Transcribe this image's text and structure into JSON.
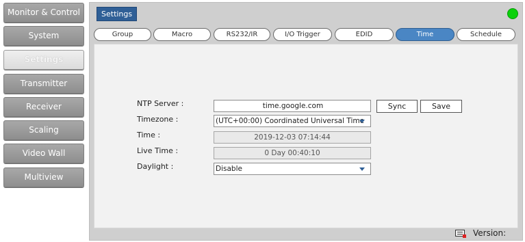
{
  "sidebar": {
    "items": [
      {
        "label": "Monitor & Control",
        "active": false
      },
      {
        "label": "System",
        "active": false
      },
      {
        "label": "Settings",
        "active": true
      },
      {
        "label": "Transmitter",
        "active": false
      },
      {
        "label": "Receiver",
        "active": false
      },
      {
        "label": "Scaling",
        "active": false
      },
      {
        "label": "Video Wall",
        "active": false
      },
      {
        "label": "Multiview",
        "active": false
      }
    ]
  },
  "header": {
    "breadcrumb": "Settings",
    "status_color": "#0bd10b"
  },
  "tabs": [
    {
      "label": "Group",
      "active": false
    },
    {
      "label": "Macro",
      "active": false
    },
    {
      "label": "RS232/IR",
      "active": false
    },
    {
      "label": "I/O Trigger",
      "active": false
    },
    {
      "label": "EDID",
      "active": false
    },
    {
      "label": "Time",
      "active": true
    },
    {
      "label": "Schedule",
      "active": false
    }
  ],
  "form": {
    "ntp_label": "NTP Server :",
    "ntp_value": "time.google.com",
    "sync_label": "Sync",
    "save_label": "Save",
    "timezone_label": "Timezone :",
    "timezone_value": "(UTC+00:00) Coordinated Universal Time",
    "time_label": "Time :",
    "time_value": "2019-12-03 07:14:44",
    "live_label": "Live Time :",
    "live_value": "0 Day 00:40:10",
    "daylight_label": "Daylight :",
    "daylight_value": "Disable"
  },
  "footer": {
    "icon": "keyboard-icon",
    "version_label": "Version:"
  },
  "colors": {
    "accent": "#4a86c4",
    "breadcrumb_bg": "#2f5f96"
  }
}
